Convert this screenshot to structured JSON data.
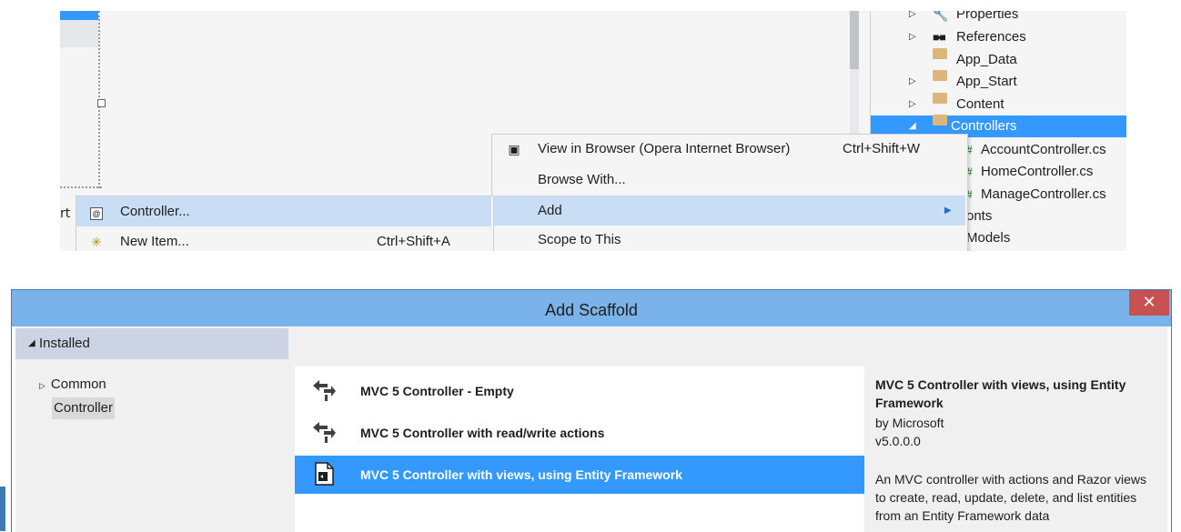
{
  "solution_explorer": {
    "items": [
      {
        "label": "Properties",
        "expander": "▷",
        "icon": "wrench-icon"
      },
      {
        "label": "References",
        "expander": "▷",
        "icon": "references-icon"
      },
      {
        "label": "App_Data",
        "expander": "",
        "icon": "folder-icon"
      },
      {
        "label": "App_Start",
        "expander": "▷",
        "icon": "folder-icon"
      },
      {
        "label": "Content",
        "expander": "▷",
        "icon": "folder-icon"
      },
      {
        "label": "Controllers",
        "expander": "◢",
        "icon": "folder-icon",
        "selected": true
      },
      {
        "label": "AccountController.cs",
        "icon": "csharp-icon"
      },
      {
        "label": "HomeController.cs",
        "icon": "csharp-icon"
      },
      {
        "label": "ManageController.cs",
        "icon": "csharp-icon"
      },
      {
        "label": "onts",
        "partial": true
      },
      {
        "label": "Models",
        "partial": true
      }
    ]
  },
  "context_menu": {
    "items": [
      {
        "label": "View in Browser (Opera Internet Browser)",
        "shortcut": "Ctrl+Shift+W",
        "icon": "browser-icon"
      },
      {
        "label": "Browse With...",
        "shortcut": ""
      },
      {
        "label": "Add",
        "shortcut": "",
        "submenu": true,
        "highlighted": true
      },
      {
        "label": "Scope to This",
        "shortcut": ""
      }
    ]
  },
  "add_submenu": {
    "left_stub": "rt",
    "items": [
      {
        "label": "Controller...",
        "shortcut": "",
        "icon": "controller-icon",
        "highlighted": true
      },
      {
        "label": "New Item...",
        "shortcut": "Ctrl+Shift+A",
        "icon": "new-item-icon"
      }
    ]
  },
  "dialog": {
    "title": "Add Scaffold",
    "close_label": "✕",
    "categories": {
      "installed": "Installed",
      "items": [
        "Common",
        "Controller"
      ]
    },
    "templates": [
      {
        "label": "MVC 5 Controller - Empty"
      },
      {
        "label": "MVC 5 Controller with read/write actions"
      },
      {
        "label": "MVC 5 Controller with views, using Entity Framework",
        "selected": true
      }
    ],
    "details": {
      "name": "MVC 5 Controller with views, using Entity Framework",
      "author": "by Microsoft",
      "version": "v5.0.0.0",
      "description": "An MVC controller with actions and Razor views to create, read, update, delete, and list entities from an Entity Framework data"
    }
  },
  "colors": {
    "selection_blue": "#3399ff",
    "menu_highlight": "#c9def5",
    "titlebar": "#7ab3ea",
    "close_red": "#c75050",
    "folder": "#dcb67a"
  }
}
